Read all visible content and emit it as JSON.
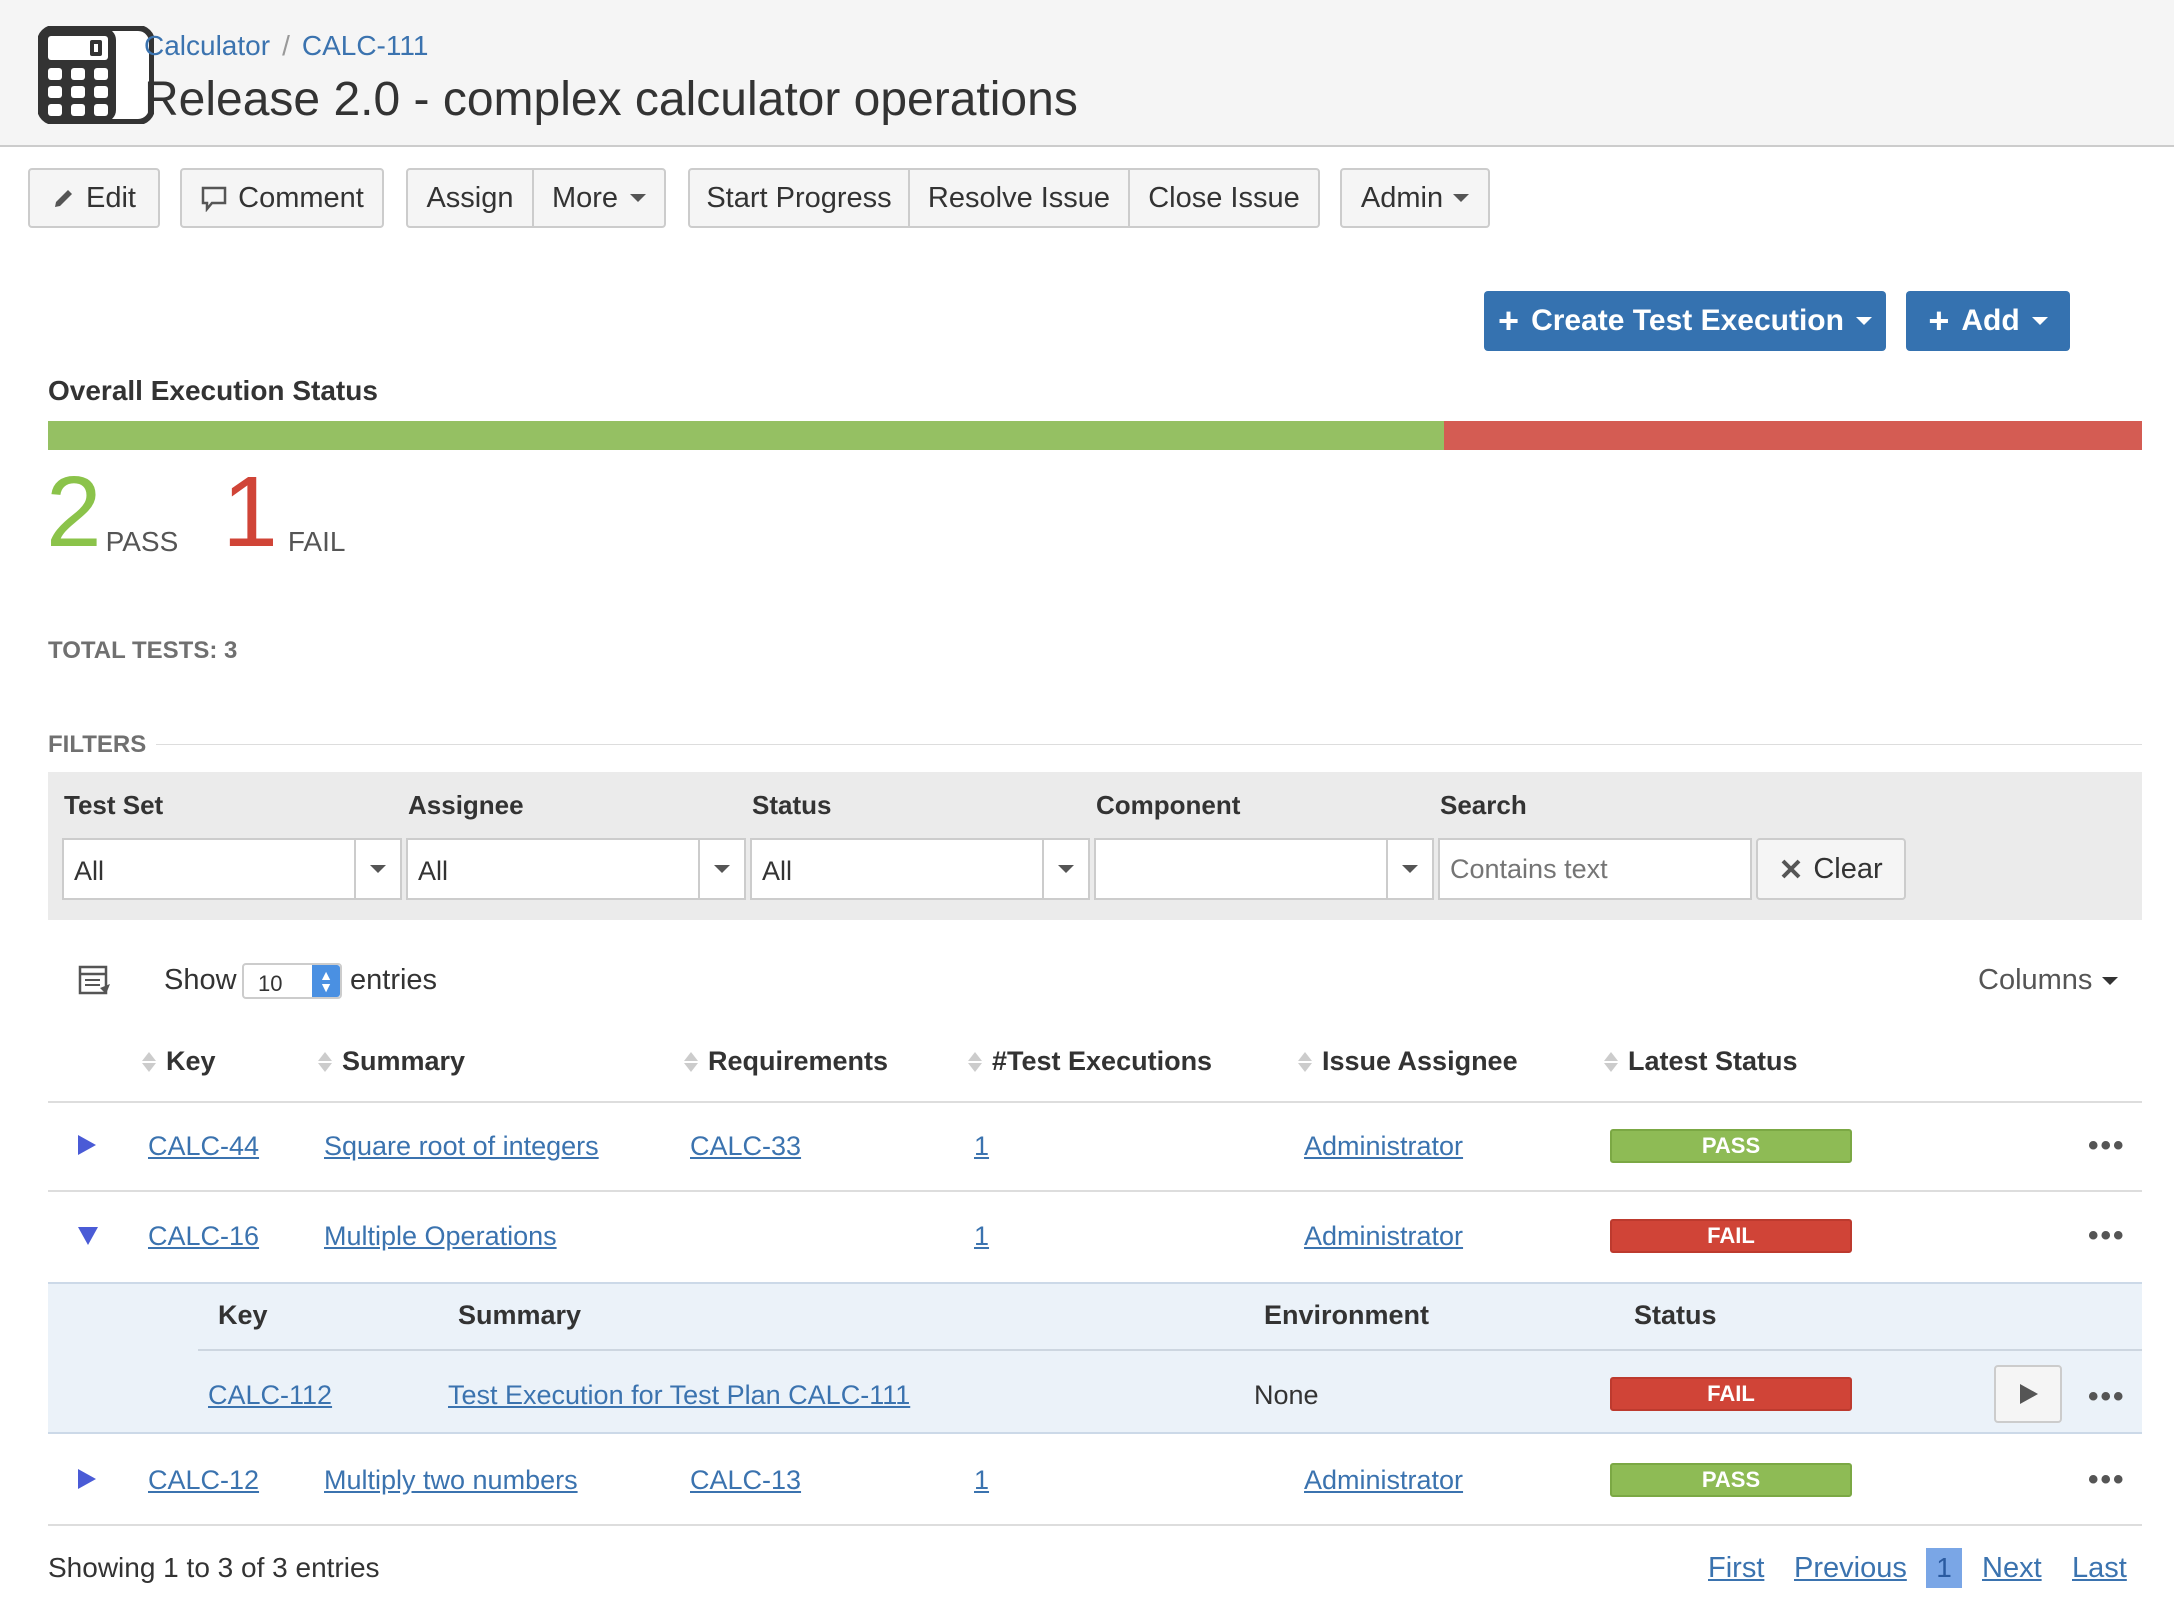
{
  "colors": {
    "accent": "#3572b0",
    "link": "#3b73af",
    "pass": "#8ebb55",
    "fail": "#d04437"
  },
  "icons": {
    "project": "calculator-icon",
    "edit": "pencil-icon",
    "comment": "speech-bubble-icon",
    "clear": "close-icon",
    "table_tools": "table-settings-icon",
    "play": "play-icon",
    "expand": "triangle-right-icon",
    "collapse": "triangle-down-icon"
  },
  "breadcrumb": {
    "project": "Calculator",
    "separator": "/",
    "issue": "CALC-111"
  },
  "page_title": "Release 2.0 - complex calculator operations",
  "toolbar": {
    "edit": "Edit",
    "comment": "Comment",
    "assign": "Assign",
    "more": "More",
    "start_progress": "Start Progress",
    "resolve_issue": "Resolve Issue",
    "close_issue": "Close Issue",
    "admin": "Admin"
  },
  "actions": {
    "create_test_execution": "Create Test Execution",
    "add": "Add"
  },
  "overall": {
    "title": "Overall Execution Status",
    "pass_count": "2",
    "pass_label": "PASS",
    "fail_count": "1",
    "fail_label": "FAIL",
    "pass_fraction": 0.6667,
    "fail_fraction": 0.3333,
    "total": "TOTAL TESTS: 3"
  },
  "filters": {
    "title": "FILTERS",
    "test_set": {
      "label": "Test Set",
      "value": "All"
    },
    "assignee": {
      "label": "Assignee",
      "value": "All"
    },
    "status": {
      "label": "Status",
      "value": "All"
    },
    "component": {
      "label": "Component",
      "value": ""
    },
    "search": {
      "label": "Search",
      "placeholder": "Contains text"
    },
    "clear": "Clear"
  },
  "table_controls": {
    "show": "Show",
    "page_size": "10",
    "entries": "entries",
    "columns": "Columns"
  },
  "table": {
    "headers": {
      "key": "Key",
      "summary": "Summary",
      "requirements": "Requirements",
      "executions": "#Test Executions",
      "assignee": "Issue Assignee",
      "status": "Latest Status"
    },
    "rows": [
      {
        "key": "CALC-44",
        "summary": "Square root of integers",
        "requirements": "CALC-33",
        "executions": "1",
        "assignee": "Administrator",
        "status": "PASS",
        "more": "•••"
      },
      {
        "key": "CALC-16",
        "summary": "Multiple Operations",
        "requirements": "",
        "executions": "1",
        "assignee": "Administrator",
        "status": "FAIL",
        "more": "•••"
      },
      {
        "key": "CALC-12",
        "summary": "Multiply two numbers",
        "requirements": "CALC-13",
        "executions": "1",
        "assignee": "Administrator",
        "status": "PASS",
        "more": "•••"
      }
    ],
    "sub": {
      "headers": {
        "key": "Key",
        "summary": "Summary",
        "environment": "Environment",
        "status": "Status"
      },
      "rows": [
        {
          "key": "CALC-112",
          "summary": "Test Execution for Test Plan CALC-111",
          "environment": "None",
          "status": "FAIL",
          "more": "•••"
        }
      ]
    }
  },
  "footer": {
    "info": "Showing 1 to 3 of 3 entries",
    "first": "First",
    "previous": "Previous",
    "current": "1",
    "next": "Next",
    "last": "Last"
  }
}
